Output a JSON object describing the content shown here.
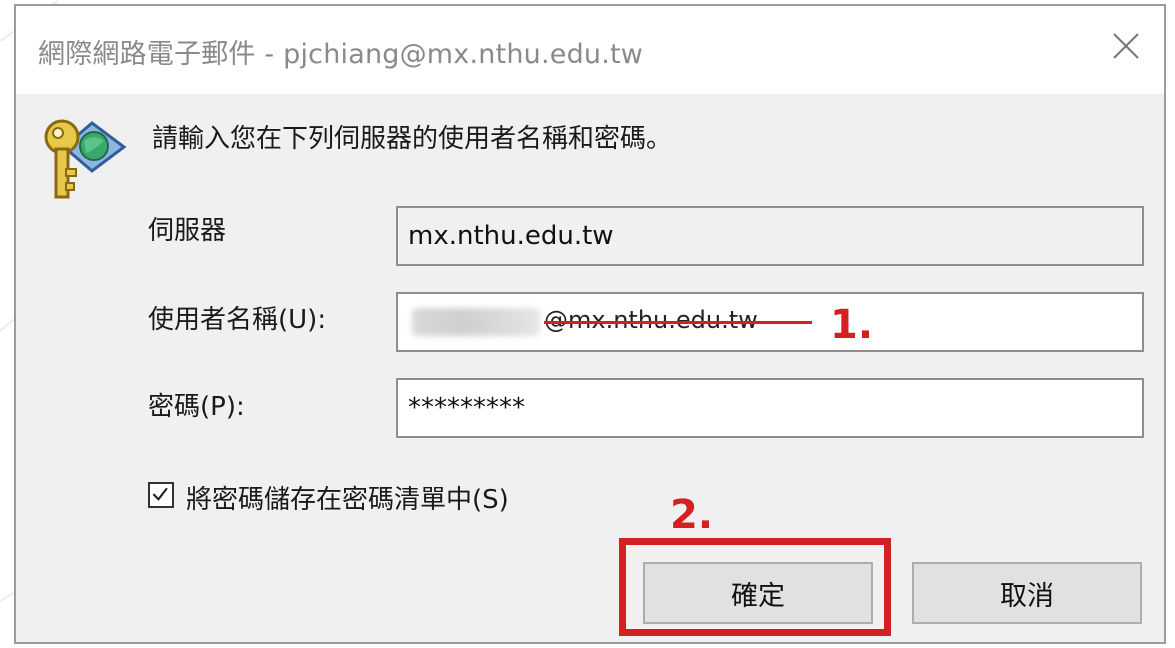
{
  "dialog": {
    "title": "網際網路電子郵件 - pjchiang@mx.nthu.edu.tw",
    "prompt": "請輸入您在下列伺服器的使用者名稱和密碼。"
  },
  "form": {
    "server_label": "伺服器",
    "server_value": "mx.nthu.edu.tw",
    "username_label": "使用者名稱(U):",
    "username_domain": "@mx.nthu.edu.tw",
    "password_label": "密碼(P):",
    "password_value": "*********",
    "remember_label": "將密碼儲存在密碼清單中(S)",
    "remember_checked": true
  },
  "buttons": {
    "ok_label": "確定",
    "cancel_label": "取消"
  },
  "annotations": {
    "step1": "1.",
    "step2": "2.",
    "accent_color": "#d42020"
  },
  "icons": {
    "dialog_icon": "key-globe-icon",
    "close": "close-icon",
    "check": "checkmark-icon"
  }
}
